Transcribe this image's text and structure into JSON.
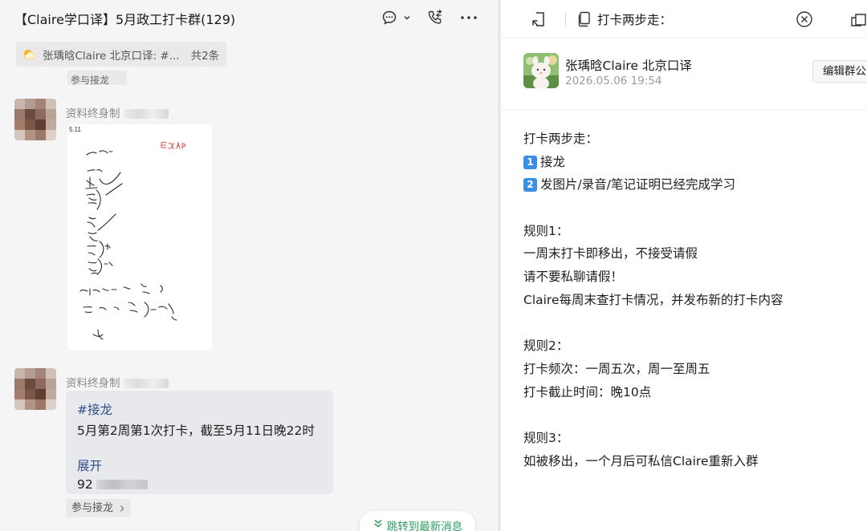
{
  "chat": {
    "title": "【Claire学口译】5月政工打卡群(129)",
    "pinned": {
      "text": "张瑀晗Claire 北京口译: #...",
      "count": "共2条"
    },
    "partial_pill": "参与接龙",
    "messages": [
      {
        "sender": "资料终身制",
        "type": "image",
        "image": {
          "top_date": "5.11",
          "lines": [
            "- 1小时 →",
            "地X",
            "主任",
            "声音",
            "政策",
            "不一",
            "六分",
            "4大国 + 方：",
            "五大 W 培训",
            "之"
          ],
          "tag": "ESCAP"
        }
      },
      {
        "sender": "资料终身制",
        "type": "solitaire",
        "tag": "#接龙",
        "line": "5月第2周第1次打卡，截至5月11日晚22时",
        "expand": "展开",
        "number_prefix": "92"
      }
    ],
    "join_label": "参与接龙",
    "jump_latest": "跳转到最新消息"
  },
  "panel": {
    "title": "打卡两步走：",
    "author_name": "张瑀晗Claire 北京口译",
    "author_time": "2026.05.06 19:54",
    "edit_button": "编辑群公",
    "content": [
      {
        "text": "打卡两步走："
      },
      {
        "keycap": "1",
        "text": "接龙"
      },
      {
        "keycap": "2",
        "text": "发图片/录音/笔记证明已经完成学习"
      },
      {
        "text": ""
      },
      {
        "text": "规则1："
      },
      {
        "text": "一周末打卡即移出，不接受请假"
      },
      {
        "text": "请不要私聊请假！"
      },
      {
        "text": "Claire每周末查打卡情况，并发布新的打卡内容"
      },
      {
        "text": ""
      },
      {
        "text": "规则2："
      },
      {
        "text": "打卡频次：一周五次，周一至周五"
      },
      {
        "text": "打卡截止时间：晚10点"
      },
      {
        "text": ""
      },
      {
        "text": "规则3："
      },
      {
        "text": "如被移出，一个月后可私信Claire重新入群"
      }
    ]
  },
  "icons": {
    "header": [
      "chat-bubble-icon",
      "chevron-down-icon",
      "phone-transfer-icon",
      "more-icon"
    ],
    "panel": [
      "collapse-panel-icon",
      "document-icon",
      "close-circle-icon",
      "open-window-icon"
    ]
  },
  "colors": {
    "link": "#2f4f8a",
    "green": "#2e9f62",
    "keycap": "#3a8ee6",
    "bubble": "#e8e9ed"
  }
}
